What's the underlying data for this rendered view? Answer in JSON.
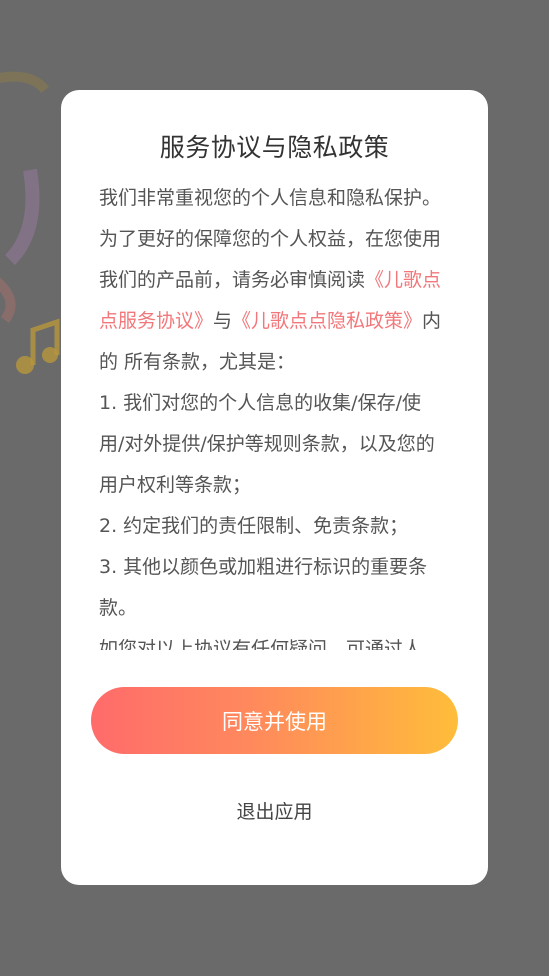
{
  "dialog": {
    "title": "服务协议与隐私政策",
    "intro_1": "我们非常重视您的个人信息和隐私保护。为了更好的保障您的个人权益，在您使用我们的产品前，请务必审慎阅读",
    "service_link": "《儿歌点点服务协议》",
    "and_text": "与",
    "privacy_link": "《儿歌点点隐私政策》",
    "intro_2": "内的 所有条款，尤其是：",
    "item_1": "1. 我们对您的个人信息的收集/保存/使用/对外提供/保护等规则条款，以及您的用户权利等条款；",
    "item_2": "2. 约定我们的责任限制、免责条款；",
    "item_3": "3. 其他以颜色或加粗进行标识的重要条款。",
    "item_4": "如您对以上协议有任何疑问，可通过人",
    "agree_label": "同意并使用",
    "exit_label": "退出应用"
  },
  "colors": {
    "overlay": "#6a6a6a",
    "link": "#f2777a",
    "button_gradient_start": "#ff6b6b",
    "button_gradient_end": "#ffbd3a"
  }
}
